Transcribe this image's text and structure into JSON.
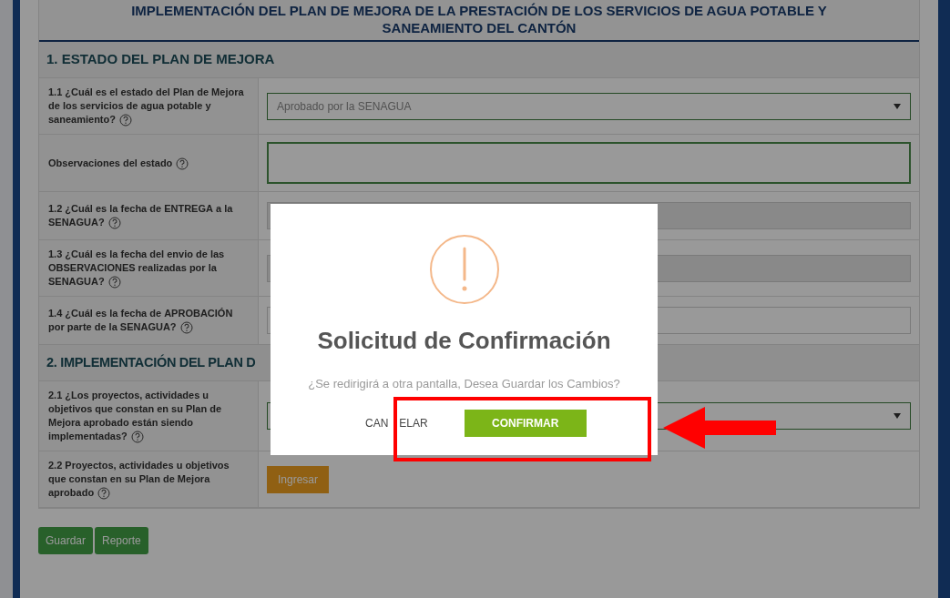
{
  "page_title": [
    "IMPLEMENTACIÓN DEL PLAN DE MEJORA DE LA PRESTACIÓN DE LOS SERVICIOS DE AGUA POTABLE Y",
    "SANEAMIENTO DEL CANTÓN"
  ],
  "sections": [
    {
      "title": "1. ESTADO DEL PLAN DE MEJORA",
      "rows": [
        {
          "label": "**1.1 ¿Cuál es el estado del Plan de Mejora de los servicios de agua potable y saneamiento?**",
          "kind": "select",
          "value": "Aprobado por la SENAGUA"
        },
        {
          "label": "**Observaciones del estado**",
          "kind": "textarea"
        },
        {
          "label": "1.2 ¿Cuál es la fecha de **ENTREGA** a la SENAGUA?",
          "kind": "date",
          "disabled": true
        },
        {
          "label": "1.3 ¿Cuál es la fecha del envio de las **OBSERVACIONES** realizadas por la SENAGUA?",
          "kind": "date",
          "disabled": true
        },
        {
          "label": "1.4 ¿Cuál es la fecha de **APROBACIÓN** por parte de la SENAGUA?",
          "kind": "date",
          "disabled": false
        }
      ]
    },
    {
      "title": "2. IMPLEMENTACIÓN DEL PLAN D",
      "rows": [
        {
          "label": "2.1 ¿Los proyectos, actividades u objetivos que constan en su Plan de Mejora aprobado están siendo implementadas?",
          "kind": "select"
        },
        {
          "label": "2.2 Proyectos, actividades u objetivos que constan en su Plan de Mejora aprobado",
          "kind": "button",
          "button": "Ingresar"
        }
      ]
    }
  ],
  "buttons": [
    "Guardar",
    "Reporte"
  ],
  "dialog": {
    "title": "Solicitud de Confirmación",
    "message": "¿Se redirigirá a otra pantalla, Desea Guardar los Cambios?",
    "cancel": "CAN",
    "cancel_rest": "ELAR",
    "confirm": "CONFIRMAR"
  }
}
